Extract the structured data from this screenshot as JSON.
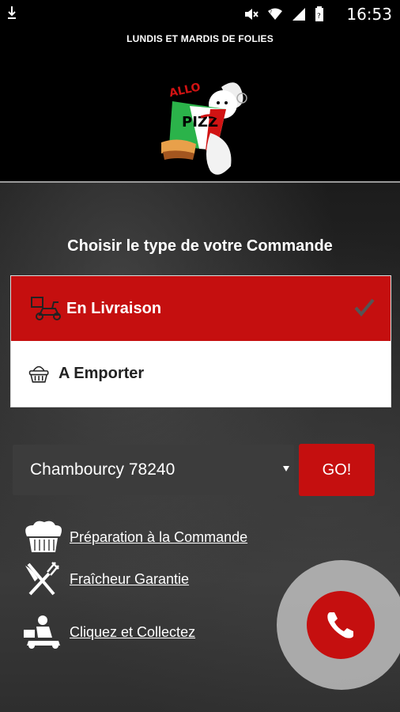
{
  "status_bar": {
    "time": "16:53",
    "icons": [
      "download-icon",
      "mute-icon",
      "wifi-icon",
      "signal-icon",
      "battery-icon"
    ]
  },
  "header": {
    "marquee": "LUNDIS ET MARDIS DE FOLIES",
    "logo": "pizza-chef-logo",
    "logo_text": "ALLO PIZZA"
  },
  "order": {
    "title": "Choisir le type de votre Commande",
    "options": [
      {
        "label": "En Livraison",
        "icon": "delivery-scooter-icon",
        "selected": true
      },
      {
        "label": "A Emporter",
        "icon": "basket-icon",
        "selected": false
      }
    ]
  },
  "city": {
    "selected": "Chambourcy 78240"
  },
  "go_label": "GO!",
  "features": [
    {
      "label": "Préparation à la Commande",
      "icon": "chef-hat-icon"
    },
    {
      "label": "Fraîcheur Garantie",
      "icon": "knife-fork-icon"
    },
    {
      "label": "Cliquez et Collectez",
      "icon": "delivery-person-icon"
    }
  ],
  "call_button": {
    "icon": "phone-icon"
  },
  "colors": {
    "accent": "#c50f0f",
    "background": "#000000",
    "select_bg": "#3c3c3c"
  }
}
